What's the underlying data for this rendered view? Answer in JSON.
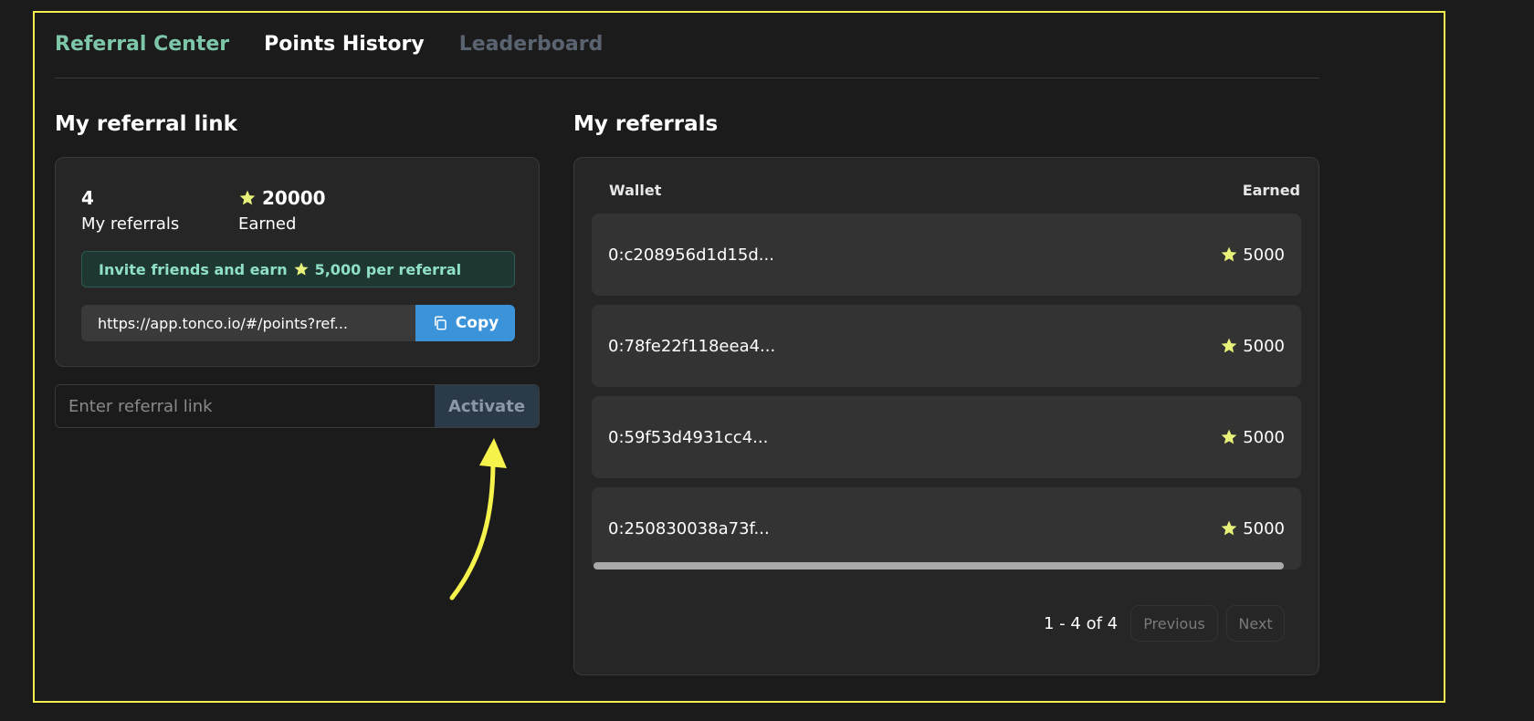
{
  "tabs": [
    {
      "label": "Referral Center",
      "state": "active"
    },
    {
      "label": "Points History",
      "state": "normal"
    },
    {
      "label": "Leaderboard",
      "state": "disabled"
    }
  ],
  "referral_link_section": {
    "title": "My referral link",
    "referrals_count": "4",
    "referrals_label": "My referrals",
    "earned_value": "20000",
    "earned_label": "Earned",
    "invite_prefix": "Invite friends and earn",
    "invite_suffix": "5,000 per referral",
    "link": "https://app.tonco.io/#/points?ref...",
    "copy_label": "Copy"
  },
  "activate": {
    "placeholder": "Enter referral link",
    "button_label": "Activate"
  },
  "referrals_section": {
    "title": "My referrals",
    "col_wallet": "Wallet",
    "col_earned": "Earned",
    "rows": [
      {
        "wallet": "0:c208956d1d15d...",
        "earned": "5000"
      },
      {
        "wallet": "0:78fe22f118eea4...",
        "earned": "5000"
      },
      {
        "wallet": "0:59f53d4931cc4...",
        "earned": "5000"
      },
      {
        "wallet": "0:250830038a73f...",
        "earned": "5000"
      }
    ],
    "pagination": {
      "info": "1 - 4 of 4",
      "prev_label": "Previous",
      "next_label": "Next"
    }
  },
  "colors": {
    "accent_green": "#7dc7a8",
    "star_yellow": "#e8f27a",
    "copy_blue": "#3b93d9",
    "frame_yellow": "#f4ee4e"
  }
}
